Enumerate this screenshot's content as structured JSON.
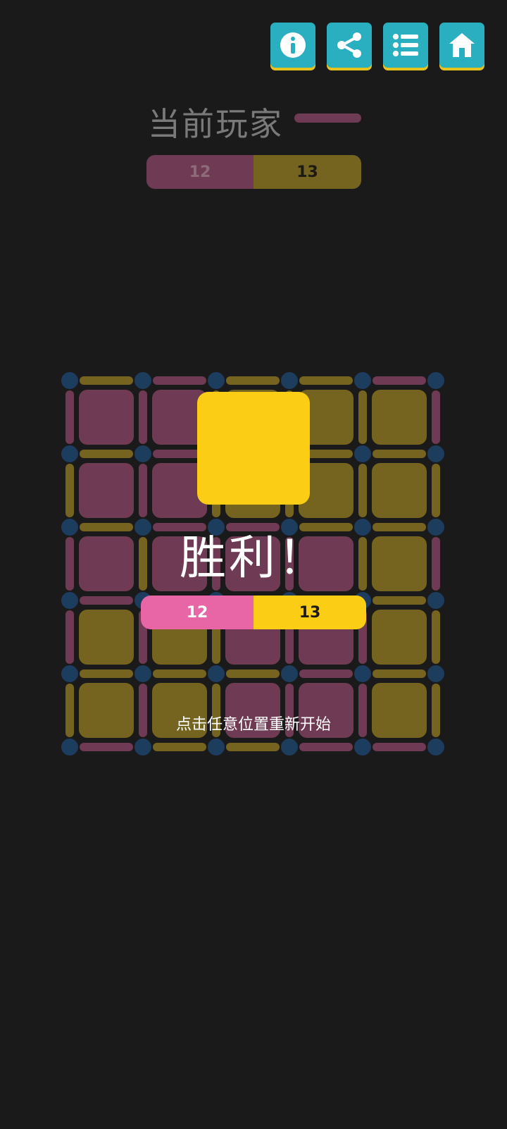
{
  "toolbar": {
    "buttons": [
      {
        "name": "info-button",
        "icon": "info-icon"
      },
      {
        "name": "share-button",
        "icon": "share-icon"
      },
      {
        "name": "menu-button",
        "icon": "list-icon"
      },
      {
        "name": "home-button",
        "icon": "home-icon"
      }
    ],
    "color": "#2aafc1",
    "shadow_color": "#e6c31d"
  },
  "header": {
    "title": "当前玩家",
    "current_player_color": "#6f3a53"
  },
  "scoreboard": {
    "player1_score": "12",
    "player2_score": "13",
    "player1_color": "#6f3a53",
    "player2_color": "#756320"
  },
  "board": {
    "rows": 5,
    "cols": 5,
    "colors": {
      "p": "#6f3a53",
      "y": "#756320",
      "dot": "#1d3d5e"
    },
    "cells": [
      [
        "p",
        "p",
        "y",
        "y",
        "y"
      ],
      [
        "p",
        "p",
        "y",
        "y",
        "y"
      ],
      [
        "p",
        "p",
        "p",
        "p",
        "y"
      ],
      [
        "y",
        "y",
        "p",
        "p",
        "y"
      ],
      [
        "y",
        "y",
        "p",
        "p",
        "y"
      ]
    ],
    "h_edges": [
      [
        "y",
        "p",
        "y",
        "y",
        "p"
      ],
      [
        "y",
        "p",
        "y",
        "y",
        "y"
      ],
      [
        "y",
        "p",
        "p",
        "y",
        "y"
      ],
      [
        "p",
        "y",
        "p",
        "p",
        "y"
      ],
      [
        "y",
        "y",
        "y",
        "p",
        "y"
      ],
      [
        "p",
        "y",
        "y",
        "p",
        "p"
      ]
    ],
    "v_edges": [
      [
        "p",
        "p",
        "y",
        "y",
        "y",
        "p"
      ],
      [
        "y",
        "p",
        "y",
        "y",
        "y",
        "y"
      ],
      [
        "p",
        "y",
        "p",
        "p",
        "y",
        "p"
      ],
      [
        "p",
        "p",
        "y",
        "p",
        "p",
        "y"
      ],
      [
        "y",
        "p",
        "y",
        "p",
        "p",
        "y"
      ]
    ]
  },
  "overlay": {
    "winner_color": "#fbcd14",
    "victory_text": "胜利！",
    "result": {
      "player1_score": "12",
      "player2_score": "13",
      "player1_color": "#e866a5",
      "player2_color": "#fbcd14"
    },
    "restart_hint": "点击任意位置重新开始"
  }
}
